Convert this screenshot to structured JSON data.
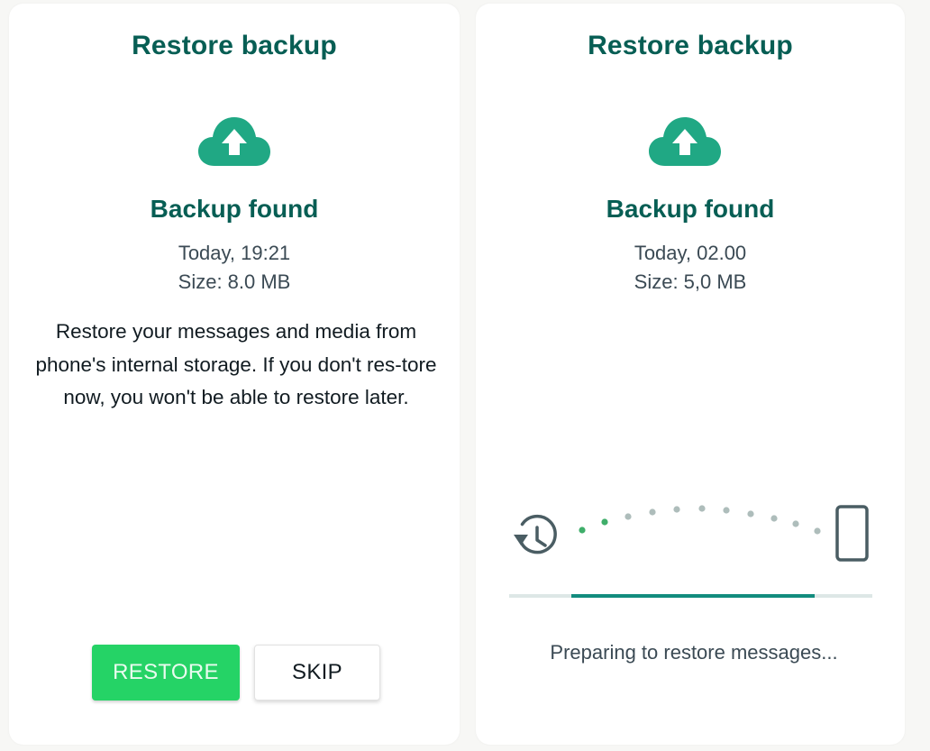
{
  "left_panel": {
    "title": "Restore backup",
    "icon": "cloud-upload-icon",
    "subtitle": "Backup found",
    "date": "Today, 19:21",
    "size": "Size: 8.0 MB",
    "description": "Restore your messages and media from phone's internal storage. If you don't res-tore now, you won't be able to restore later.",
    "restore_label": "RESTORE",
    "skip_label": "SKIP"
  },
  "right_panel": {
    "title": "Restore backup",
    "icon": "cloud-upload-icon",
    "subtitle": "Backup found",
    "date": "Today, 02.00",
    "size": "Size: 5,0 MB",
    "history_icon": "history-icon",
    "phone_icon": "phone-icon",
    "progress_fraction": 0.67,
    "progress_start_fraction": 0.17,
    "status": "Preparing to restore messages..."
  },
  "colors": {
    "brand_dark": "#075e54",
    "teal": "#128c7e",
    "accent_green": "#25d366",
    "icon_fill": "#20a884"
  }
}
